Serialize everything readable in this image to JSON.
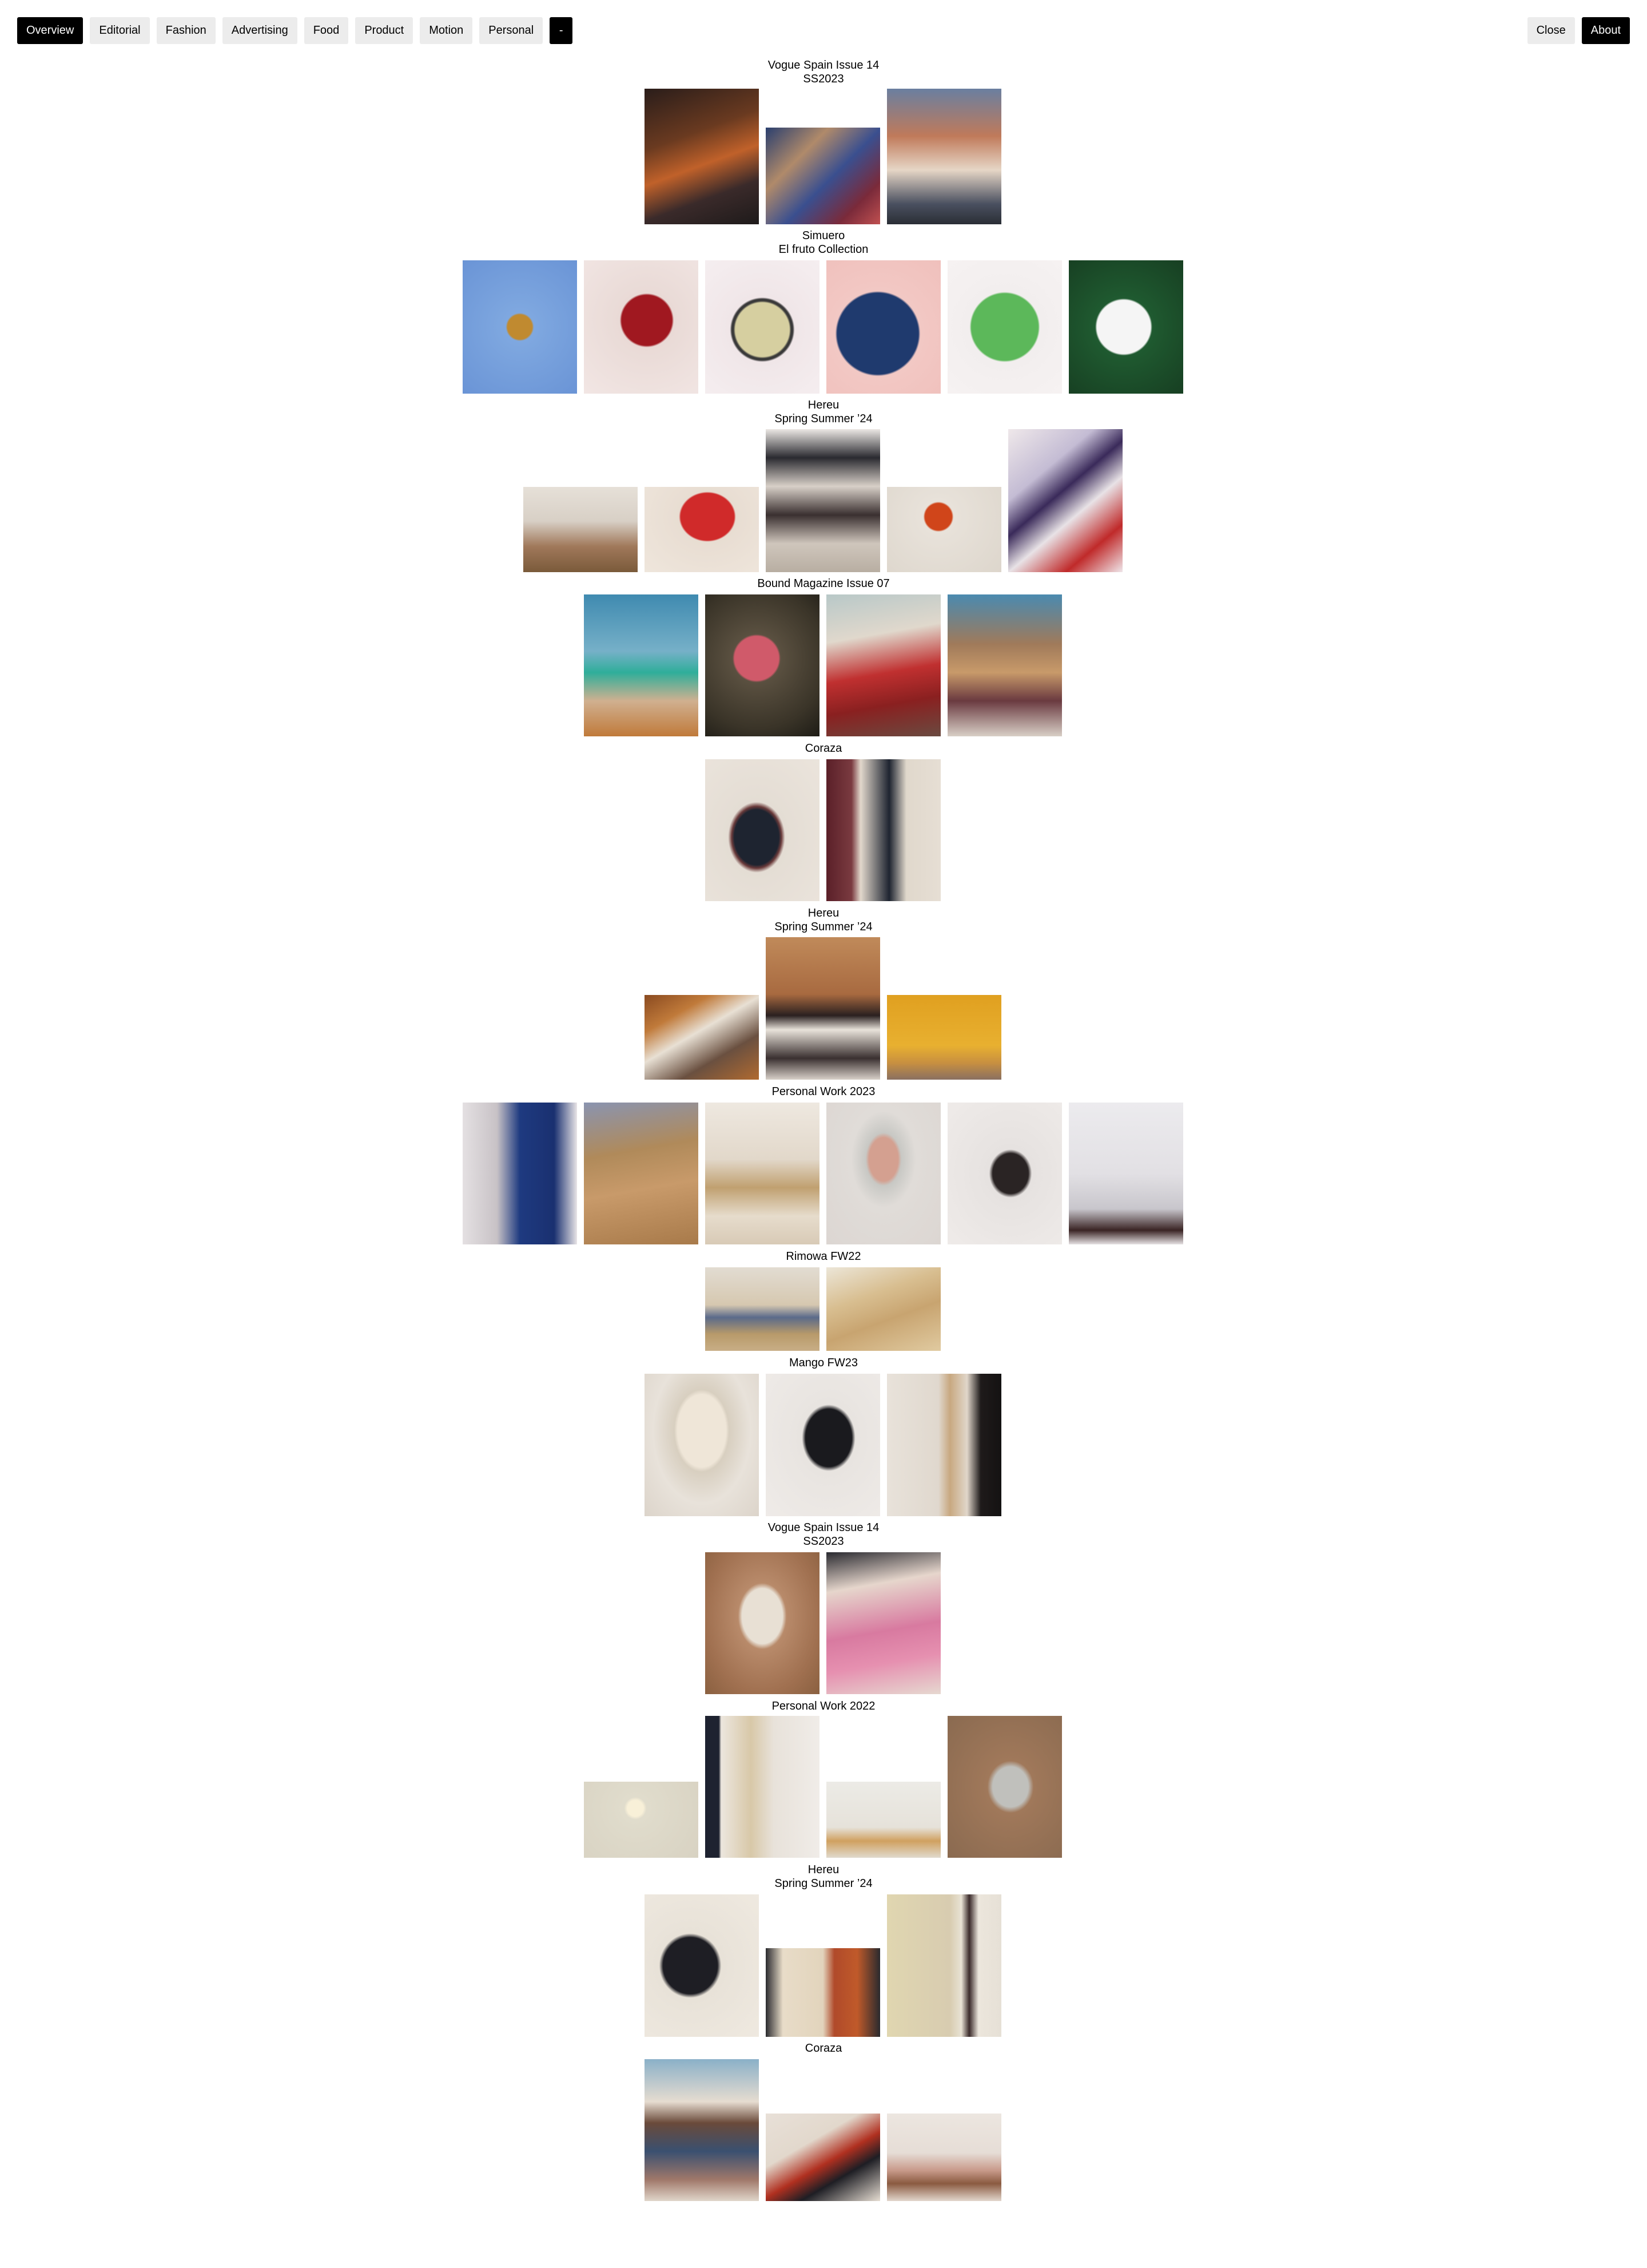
{
  "nav": {
    "left": [
      {
        "label": "Overview",
        "active": true
      },
      {
        "label": "Editorial",
        "active": false
      },
      {
        "label": "Fashion",
        "active": false
      },
      {
        "label": "Advertising",
        "active": false
      },
      {
        "label": "Food",
        "active": false
      },
      {
        "label": "Product",
        "active": false
      },
      {
        "label": "Motion",
        "active": false
      },
      {
        "label": "Personal",
        "active": false
      },
      {
        "label": "-",
        "active": true
      }
    ],
    "right": [
      {
        "label": "Close",
        "active": false
      },
      {
        "label": "About",
        "active": true
      }
    ]
  },
  "projects": [
    {
      "title": "Vogue Spain Issue 14",
      "subtitle": "SS2023",
      "image_count": 3
    },
    {
      "title": "Simuero",
      "subtitle": "El fruto Collection",
      "image_count": 6
    },
    {
      "title": "Hereu",
      "subtitle": "Spring Summer ’24",
      "image_count": 5
    },
    {
      "title": "Bound Magazine Issue 07",
      "subtitle": "",
      "image_count": 4
    },
    {
      "title": "Coraza",
      "subtitle": "",
      "image_count": 2
    },
    {
      "title": "Hereu",
      "subtitle": "Spring Summer ’24",
      "image_count": 3
    },
    {
      "title": "Personal Work 2023",
      "subtitle": "",
      "image_count": 6
    },
    {
      "title": "Rimowa FW22",
      "subtitle": "",
      "image_count": 2
    },
    {
      "title": "Mango FW23",
      "subtitle": "",
      "image_count": 3
    },
    {
      "title": "Vogue Spain Issue 14",
      "subtitle": "SS2023",
      "image_count": 2
    },
    {
      "title": "Personal Work 2022",
      "subtitle": "",
      "image_count": 4
    },
    {
      "title": "Hereu",
      "subtitle": "Spring Summer ’24",
      "image_count": 3
    },
    {
      "title": "Coraza",
      "subtitle": "",
      "image_count": 3
    }
  ]
}
